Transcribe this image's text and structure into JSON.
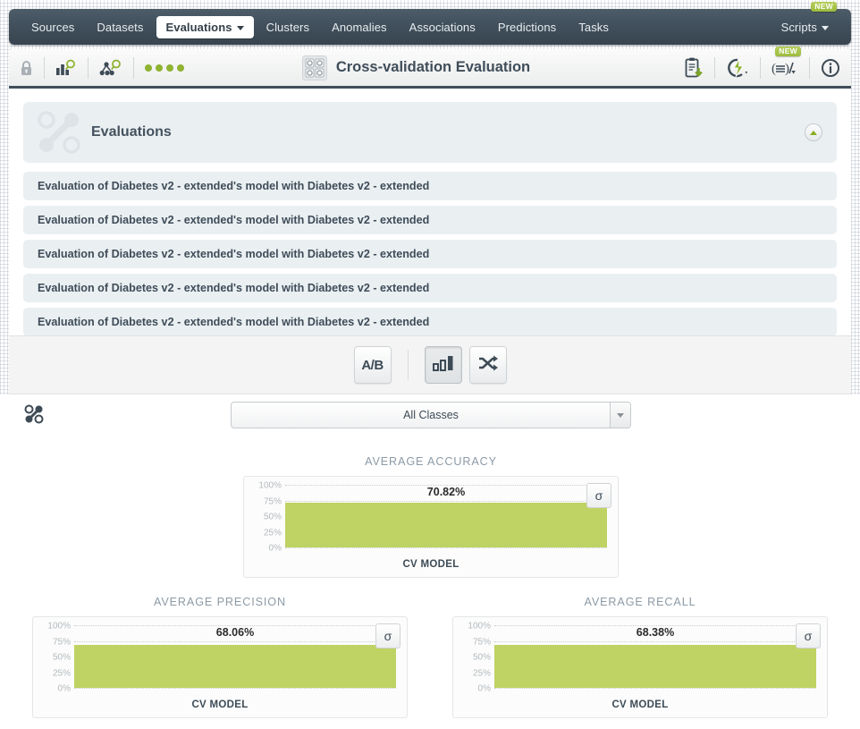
{
  "nav": {
    "items": [
      {
        "label": "Sources",
        "active": false,
        "caret": false
      },
      {
        "label": "Datasets",
        "active": false,
        "caret": false
      },
      {
        "label": "Evaluations",
        "active": true,
        "caret": true
      },
      {
        "label": "Clusters",
        "active": false,
        "caret": false
      },
      {
        "label": "Anomalies",
        "active": false,
        "caret": false
      },
      {
        "label": "Associations",
        "active": false,
        "caret": false
      },
      {
        "label": "Predictions",
        "active": false,
        "caret": false
      },
      {
        "label": "Tasks",
        "active": false,
        "caret": false
      }
    ],
    "scripts_label": "Scripts",
    "scripts_badge": "NEW"
  },
  "toolbar": {
    "lock_icon": "lock-icon",
    "chart_search_icon": "bar-chart-search-icon",
    "model_search_icon": "model-tree-search-icon",
    "status_dots": 4,
    "title": "Cross-validation Evaluation",
    "title_icon": "cross-validation-grid-icon",
    "download_icon": "clipboard-download-icon",
    "flash_icon": "flash-action-icon",
    "formula_icon": "formula-icon",
    "formula_badge": "NEW",
    "info_icon": "info-icon"
  },
  "evaluations_panel": {
    "header_title": "Evaluations",
    "header_icon": "evaluation-nodes-icon",
    "collapse_icon": "collapse-up-icon",
    "rows": [
      "Evaluation of Diabetes v2 - extended's model with Diabetes v2 - extended",
      "Evaluation of Diabetes v2 - extended's model with Diabetes v2 - extended",
      "Evaluation of Diabetes v2 - extended's model with Diabetes v2 - extended",
      "Evaluation of Diabetes v2 - extended's model with Diabetes v2 - extended",
      "Evaluation of Diabetes v2 - extended's model with Diabetes v2 - extended"
    ]
  },
  "view_switch": {
    "ab_label": "A/B",
    "ab_icon": "ab-compare-icon",
    "chart_icon": "bar-chart-icon",
    "shuffle_icon": "shuffle-arrows-icon",
    "selected": "bar-chart-icon"
  },
  "class_filter": {
    "icon": "classes-nodes-icon",
    "selected": "All Classes",
    "placeholder": "All Classes"
  },
  "sigma_label": "σ",
  "chart_data": [
    {
      "type": "bar",
      "title": "AVERAGE ACCURACY",
      "categories": [
        "CV MODEL"
      ],
      "values": [
        70.82
      ],
      "value_labels": [
        "70.82%"
      ],
      "ylabel": "",
      "xlabel": "",
      "ylim": [
        0,
        100
      ],
      "ytick_labels": [
        "100%",
        "75%",
        "50%",
        "25%",
        "0%"
      ],
      "yticks": [
        100,
        75,
        50,
        25,
        0
      ],
      "grid": true,
      "legend": false,
      "bar_color": "#bed363",
      "orientation": "vertical-fill"
    },
    {
      "type": "bar",
      "title": "AVERAGE PRECISION",
      "categories": [
        "CV MODEL"
      ],
      "values": [
        68.06
      ],
      "value_labels": [
        "68.06%"
      ],
      "ylabel": "",
      "xlabel": "",
      "ylim": [
        0,
        100
      ],
      "ytick_labels": [
        "100%",
        "75%",
        "50%",
        "25%",
        "0%"
      ],
      "yticks": [
        100,
        75,
        50,
        25,
        0
      ],
      "grid": true,
      "legend": false,
      "bar_color": "#bed363",
      "orientation": "vertical-fill"
    },
    {
      "type": "bar",
      "title": "AVERAGE RECALL",
      "categories": [
        "CV MODEL"
      ],
      "values": [
        68.38
      ],
      "value_labels": [
        "68.38%"
      ],
      "ylabel": "",
      "xlabel": "",
      "ylim": [
        0,
        100
      ],
      "ytick_labels": [
        "100%",
        "75%",
        "50%",
        "25%",
        "0%"
      ],
      "yticks": [
        100,
        75,
        50,
        25,
        0
      ],
      "grid": true,
      "legend": false,
      "bar_color": "#bed363",
      "orientation": "vertical-fill"
    }
  ],
  "colors": {
    "accent_green": "#bed363",
    "badge_green": "#a7c44a",
    "nav_dark": "#41505c",
    "panel_row": "#eaeff2"
  }
}
